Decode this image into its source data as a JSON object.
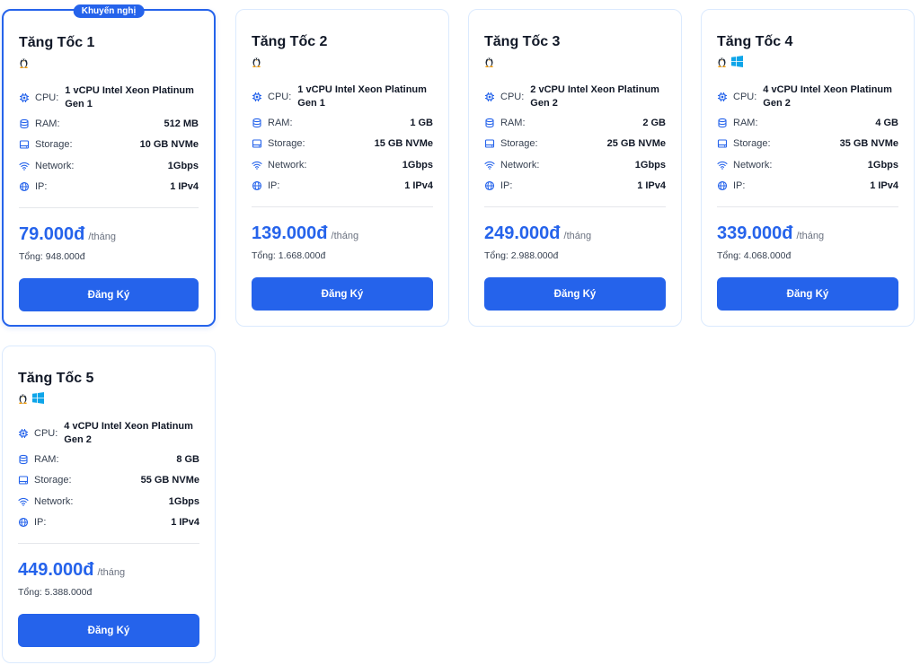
{
  "labels": {
    "cpu": "CPU:",
    "ram": "RAM:",
    "storage": "Storage:",
    "network": "Network:",
    "ip": "IP:",
    "per_month": "/tháng",
    "total_prefix": "Tổng: ",
    "button": "Đăng Ký",
    "badge": "Khuyến nghị"
  },
  "colors": {
    "accent": "#2563eb",
    "border": "#dbeafe"
  },
  "plans": [
    {
      "name": "Tăng Tốc 1",
      "featured": true,
      "os": [
        "linux-icon"
      ],
      "cpu": "1 vCPU Intel Xeon Platinum Gen 1",
      "ram": "512 MB",
      "storage": "10 GB NVMe",
      "network": "1Gbps",
      "ip": "1 IPv4",
      "price": "79.000đ",
      "total": "948.000đ"
    },
    {
      "name": "Tăng Tốc 2",
      "featured": false,
      "os": [
        "linux-icon"
      ],
      "cpu": "1 vCPU Intel Xeon Platinum Gen 1",
      "ram": "1 GB",
      "storage": "15 GB NVMe",
      "network": "1Gbps",
      "ip": "1 IPv4",
      "price": "139.000đ",
      "total": "1.668.000đ"
    },
    {
      "name": "Tăng Tốc 3",
      "featured": false,
      "os": [
        "linux-icon"
      ],
      "cpu": "2 vCPU Intel Xeon Platinum Gen 2",
      "ram": "2 GB",
      "storage": "25 GB NVMe",
      "network": "1Gbps",
      "ip": "1 IPv4",
      "price": "249.000đ",
      "total": "2.988.000đ"
    },
    {
      "name": "Tăng Tốc 4",
      "featured": false,
      "os": [
        "linux-icon",
        "windows-icon"
      ],
      "cpu": "4 vCPU Intel Xeon Platinum Gen 2",
      "ram": "4 GB",
      "storage": "35 GB NVMe",
      "network": "1Gbps",
      "ip": "1 IPv4",
      "price": "339.000đ",
      "total": "4.068.000đ"
    },
    {
      "name": "Tăng Tốc 5",
      "featured": false,
      "os": [
        "linux-icon",
        "windows-icon"
      ],
      "cpu": "4 vCPU Intel Xeon Platinum Gen 2",
      "ram": "8 GB",
      "storage": "55 GB NVMe",
      "network": "1Gbps",
      "ip": "1 IPv4",
      "price": "449.000đ",
      "total": "5.388.000đ"
    }
  ]
}
